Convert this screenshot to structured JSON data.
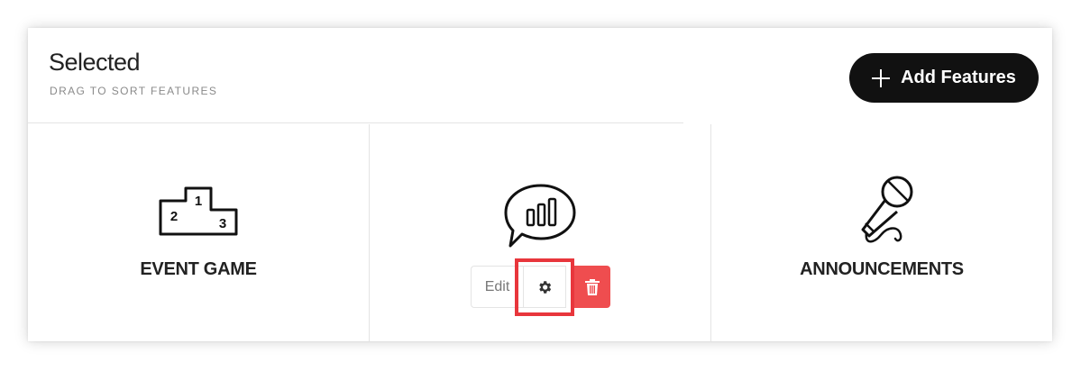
{
  "header": {
    "title": "Selected",
    "subtitle": "DRAG TO SORT FEATURES",
    "add_button_label": "Add Features"
  },
  "features": [
    {
      "label": "EVENT GAME",
      "icon": "podium-icon"
    },
    {
      "label": "",
      "icon": "poll-speech-bubble-icon"
    },
    {
      "label": "ANNOUNCEMENTS",
      "icon": "microphone-icon"
    }
  ],
  "feature_actions": {
    "edit_label": "Edit",
    "settings_icon": "gear-icon",
    "delete_icon": "trash-icon"
  },
  "colors": {
    "add_button_bg": "#111111",
    "delete_button_bg": "#ef4d4f",
    "highlight": "#e8363c"
  }
}
